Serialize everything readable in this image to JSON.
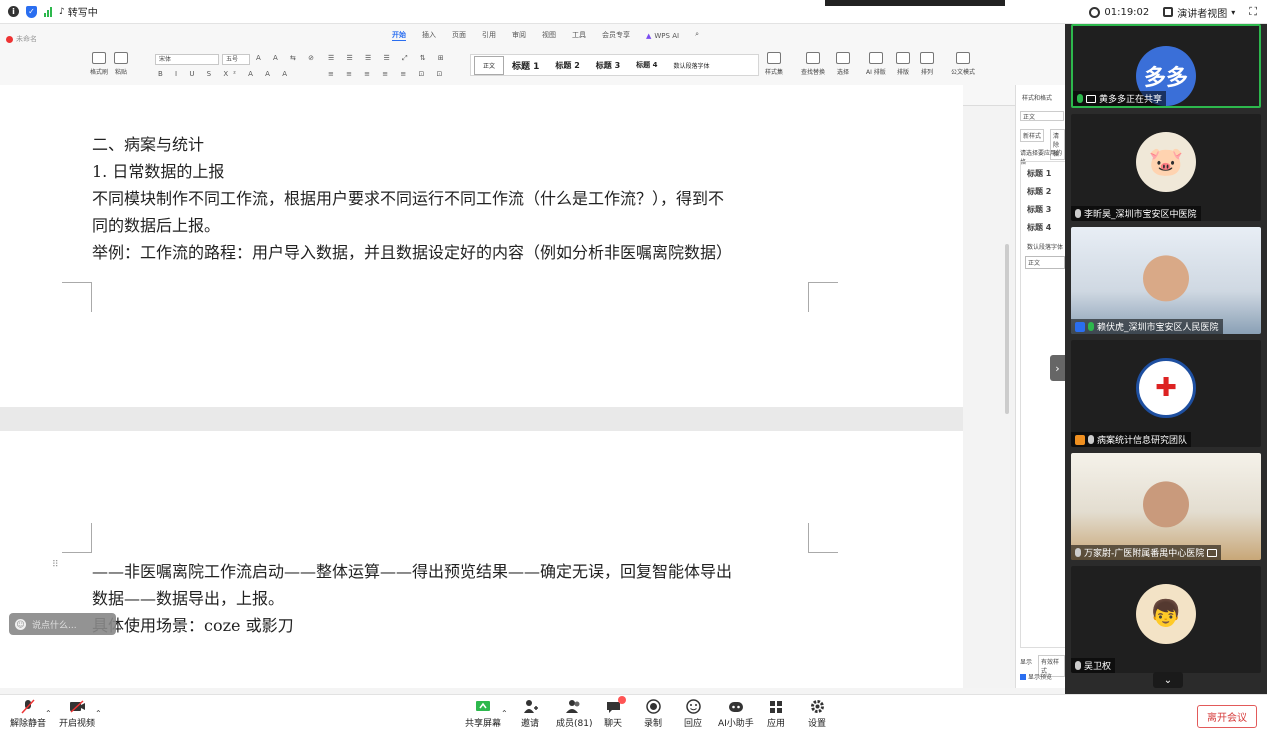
{
  "topbar": {
    "transcribing_label": "转写中",
    "timer": "01:19:02",
    "view_mode": "演讲者视图"
  },
  "wps": {
    "doc_title": "未命名",
    "tabs": [
      "开始",
      "插入",
      "页面",
      "引用",
      "审阅",
      "视图",
      "工具",
      "会员专享",
      "WPS AI"
    ],
    "active_tab": "开始",
    "ribbon": {
      "format_painter": "格式刷",
      "paste": "粘贴",
      "font_name": "宋体",
      "font_size": "五号",
      "styles": [
        "正文",
        "标题 1",
        "标题 2",
        "标题 3",
        "标题 4",
        "数认段落字体"
      ],
      "style_set": "样式集",
      "find_replace": "查找替换",
      "select": "选择",
      "ai_layout": "AI 排版",
      "layout": "排版",
      "arrange": "排列",
      "doc_mode": "公文模式"
    },
    "page1_lines": [
      "二、病案与统计",
      "1.  日常数据的上报",
      "不同模块制作不同工作流，根据用户要求不同运行不同工作流（什么是工作流？），得到不",
      "同的数据后上报。",
      "举例：工作流的路程：用户导入数据，并且数据设定好的内容（例如分析非医嘱离院数据）"
    ],
    "page2_lines": [
      "——非医嘱离院工作流启动——整体运算——得出预览结果——确定无误，回复智能体导出",
      "数据——数据导出，上报。",
      "具体使用场景：coze 或影刀"
    ],
    "comment_placeholder": "说点什么...",
    "right_panel": {
      "title": "样式和格式",
      "current": "正文",
      "new_style": "新样式",
      "clear": "清除格",
      "hint": "请选择要应用的格",
      "items": [
        "标题 1",
        "标题 2",
        "标题 3",
        "标题 4"
      ],
      "default_para": "数认段落字体",
      "body": "正文",
      "show": "显示",
      "valid": "有效样式",
      "preview": "显示预览"
    }
  },
  "participants": [
    {
      "name": "黄多多正在共享",
      "avatar_text": "多多",
      "speaking": true
    },
    {
      "name": "李昕昊_深圳市宝安区中医院",
      "avatar_text": "",
      "speaking": false
    },
    {
      "name": "赖伏虎_深圳市宝安区人民医院",
      "avatar_text": "",
      "speaking": false
    },
    {
      "name": "病案统计信息研究团队",
      "avatar_text": "",
      "speaking": false
    },
    {
      "name": "万家尉-广医附属番禺中心医院",
      "avatar_text": "",
      "speaking": false
    },
    {
      "name": "吴卫权",
      "avatar_text": "",
      "speaking": false
    }
  ],
  "bottombar": {
    "unmute": "解除静音",
    "start_video": "开启视频",
    "share_screen": "共享屏幕",
    "invite": "邀请",
    "members": "成员(81)",
    "chat": "聊天",
    "record": "录制",
    "reaction": "回应",
    "ai_assistant": "AI小助手",
    "apps": "应用",
    "settings": "设置",
    "leave": "离开会议"
  },
  "colors": {
    "accent": "#2a6ef0",
    "speaking": "#2db84d",
    "leave": "#d63b3b"
  }
}
